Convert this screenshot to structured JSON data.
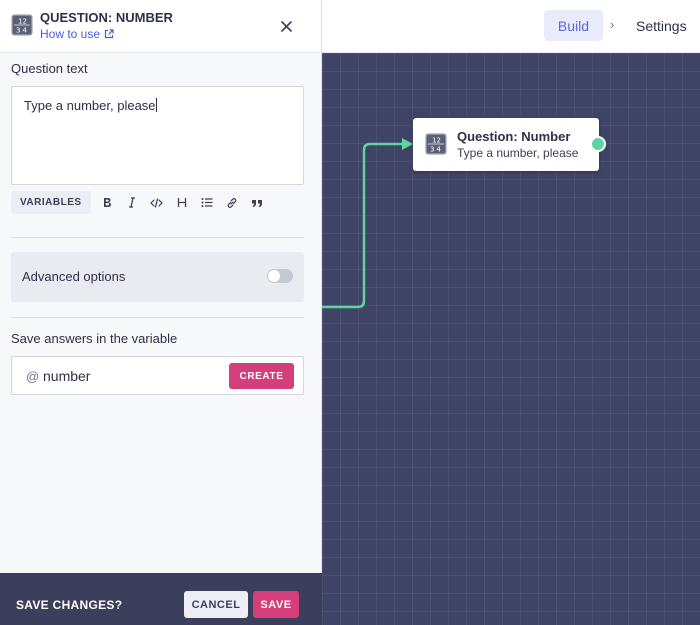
{
  "nav": {
    "build_label": "Build",
    "separator": "›",
    "settings_label": "Settings"
  },
  "panel": {
    "title": "QUESTION: NUMBER",
    "how_to_use": "How to use",
    "icon_digits": [
      "1",
      "2",
      "3",
      "4"
    ],
    "question_text_label": "Question text",
    "question_text_value": "Type a number, please",
    "toolbar": {
      "variables_label": "VARIABLES",
      "buttons": [
        "bold-icon",
        "italic-icon",
        "code-icon",
        "heading-icon",
        "list-icon",
        "link-icon",
        "quote-icon"
      ]
    },
    "advanced_options_label": "Advanced options",
    "advanced_options_enabled": false,
    "save_answers_label": "Save answers in the variable",
    "variable_prefix": "@",
    "variable_name": "number",
    "create_label": "CREATE"
  },
  "footer": {
    "save_changes_label": "SAVE CHANGES?",
    "cancel_label": "CANCEL",
    "save_label": "SAVE"
  },
  "node": {
    "title": "Question: Number",
    "subtitle": "Type a number, please"
  },
  "colors": {
    "accent": "#d43f7b",
    "link": "#4c5bd4",
    "canvas": "#3f4466",
    "connector": "#5fd3a1",
    "footer": "#3b3f5c"
  }
}
